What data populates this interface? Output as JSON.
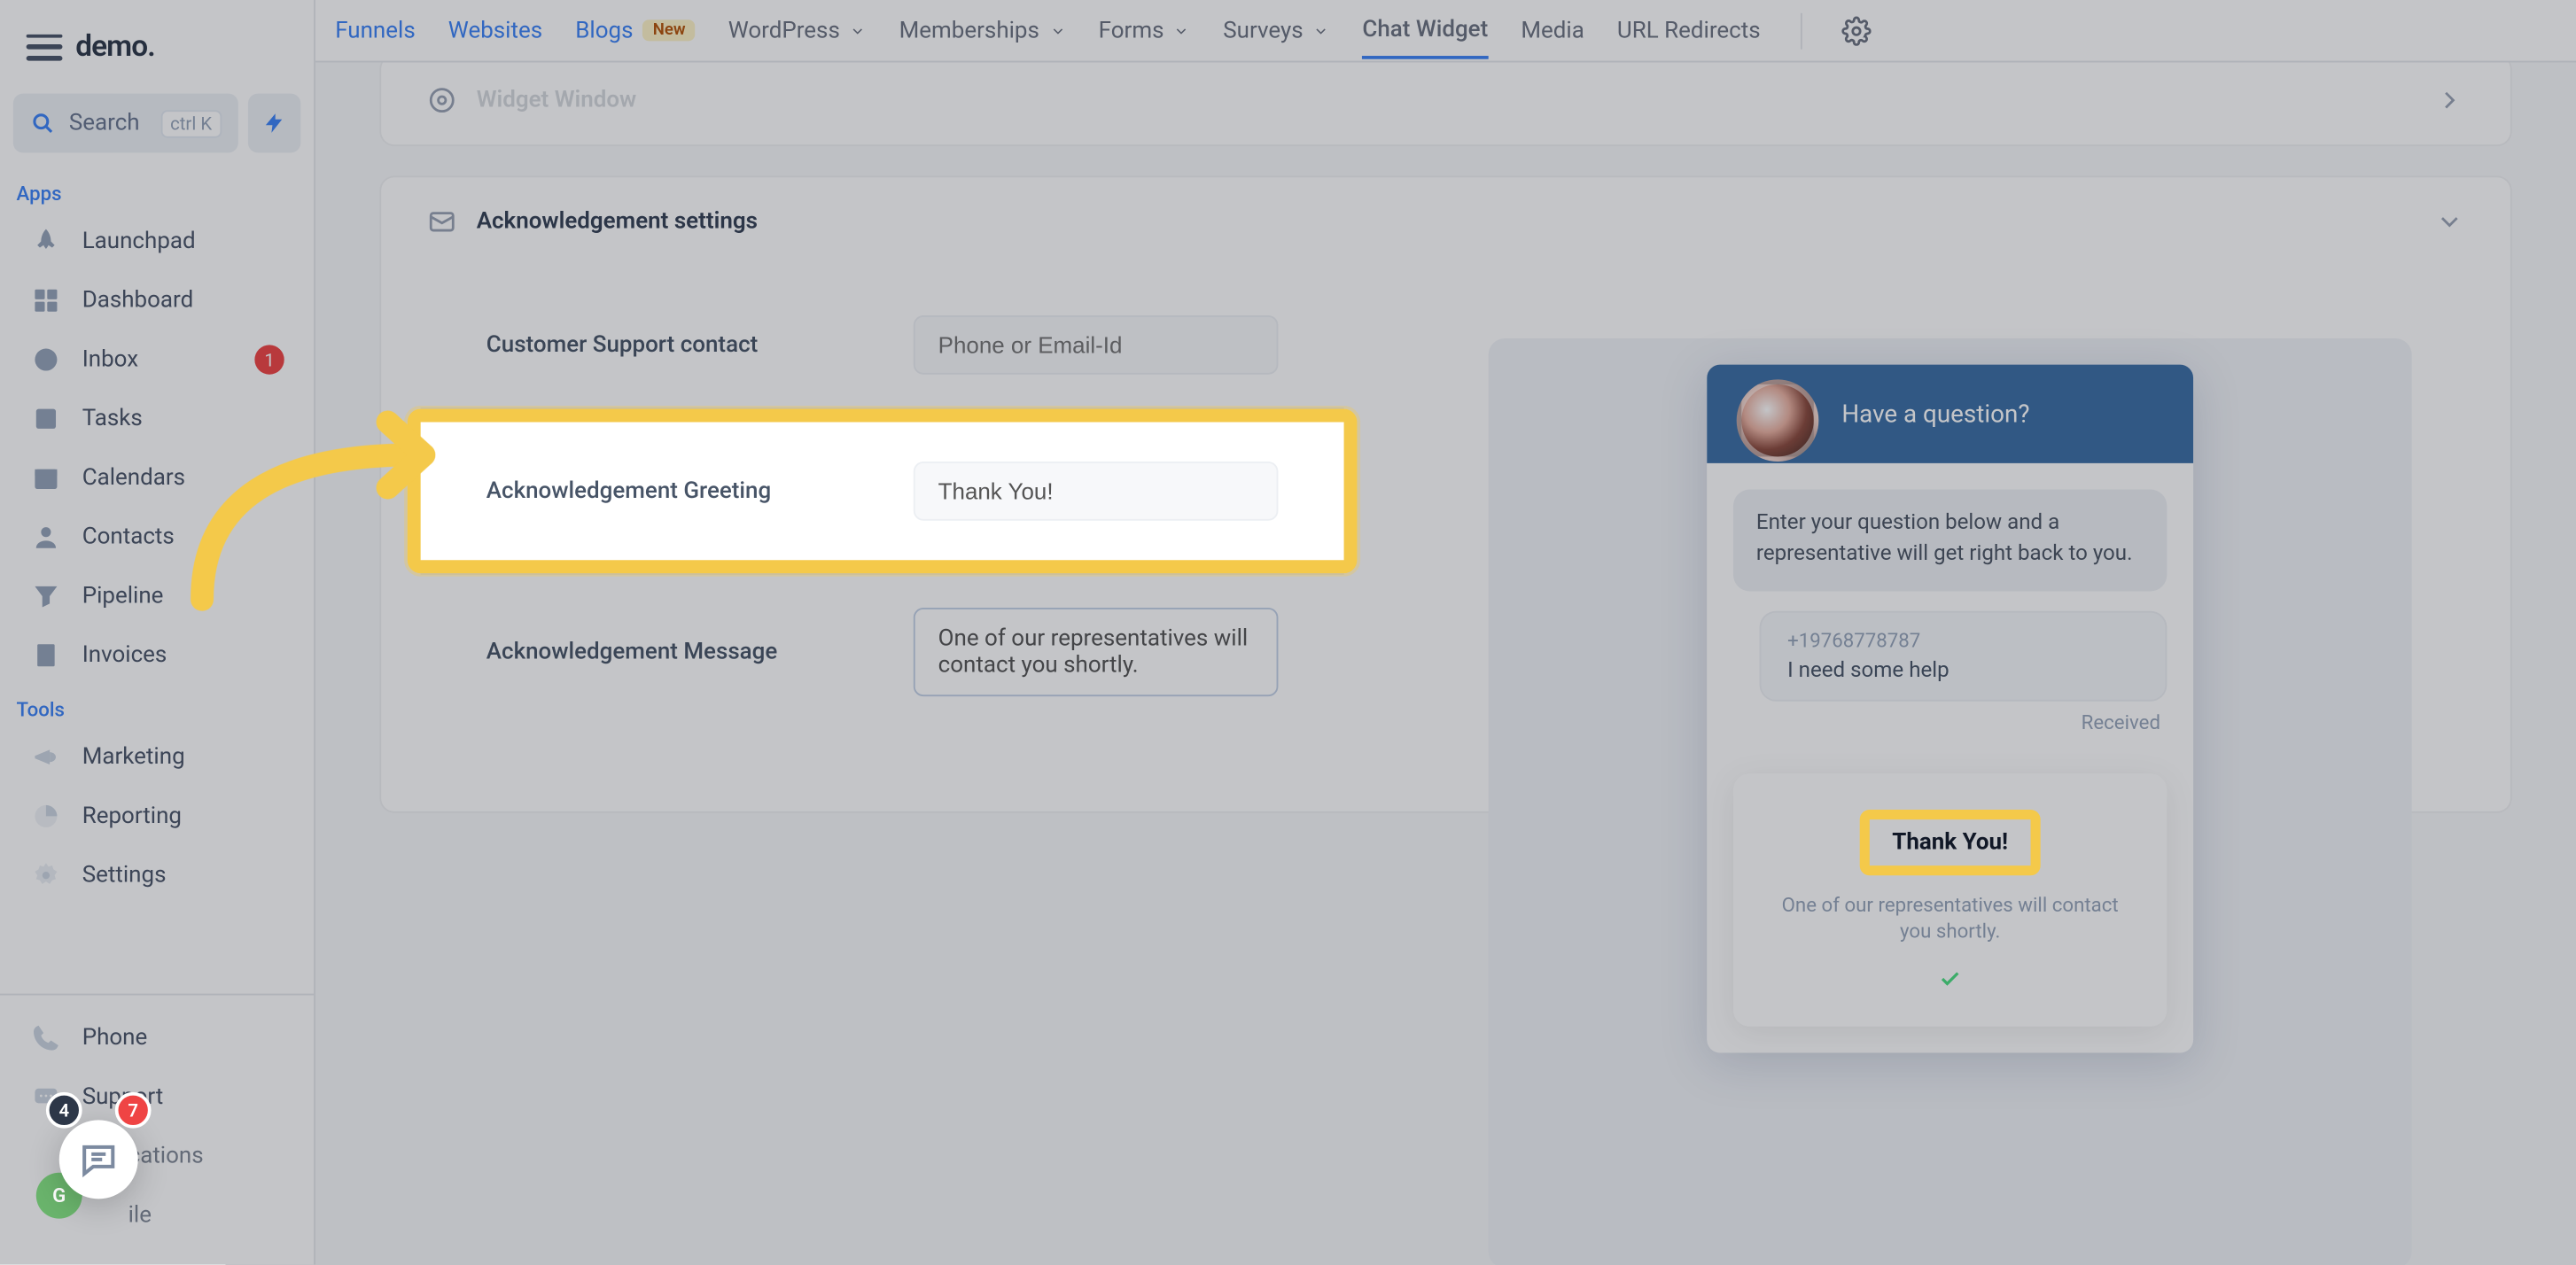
{
  "logo": "demo.",
  "search": {
    "placeholder": "Search",
    "shortcut": "ctrl K"
  },
  "section_apps": "Apps",
  "section_tools": "Tools",
  "sidebar": {
    "apps": [
      {
        "label": "Launchpad"
      },
      {
        "label": "Dashboard"
      },
      {
        "label": "Inbox",
        "badge": "1"
      },
      {
        "label": "Tasks"
      },
      {
        "label": "Calendars"
      },
      {
        "label": "Contacts"
      },
      {
        "label": "Pipeline"
      },
      {
        "label": "Invoices"
      }
    ],
    "tools": [
      {
        "label": "Marketing"
      },
      {
        "label": "Reporting"
      },
      {
        "label": "Settings"
      }
    ],
    "bottom": [
      {
        "label": "Phone"
      },
      {
        "label": "Support"
      },
      {
        "label": "cations"
      },
      {
        "label": "ile"
      }
    ]
  },
  "bubbles": {
    "b4": "4",
    "b7": "7",
    "avatar": "G"
  },
  "topbar": {
    "funnels": "Funnels",
    "websites": "Websites",
    "blogs": "Blogs",
    "new": "New",
    "wordpress": "WordPress",
    "memberships": "Memberships",
    "forms": "Forms",
    "surveys": "Surveys",
    "chat_widget": "Chat Widget",
    "media": "Media",
    "url_redirects": "URL Redirects"
  },
  "panels": {
    "window_title": "Widget Window",
    "ack_title": "Acknowledgement settings"
  },
  "form": {
    "support_label": "Customer Support contact",
    "support_placeholder": "Phone or Email-Id",
    "greeting_label": "Acknowledgement Greeting",
    "greeting_value": "Thank You!",
    "message_label": "Acknowledgement Message",
    "message_value": "One of our representatives will contact you shortly."
  },
  "chat": {
    "header": "Have a question?",
    "op_msg": "Enter your question below and a representative will get right back to you.",
    "user_phone": "+19768778787",
    "user_msg": "I need some help",
    "received": "Received",
    "thank_title": "Thank You!",
    "thank_sub": "One of our representatives will contact you shortly."
  }
}
